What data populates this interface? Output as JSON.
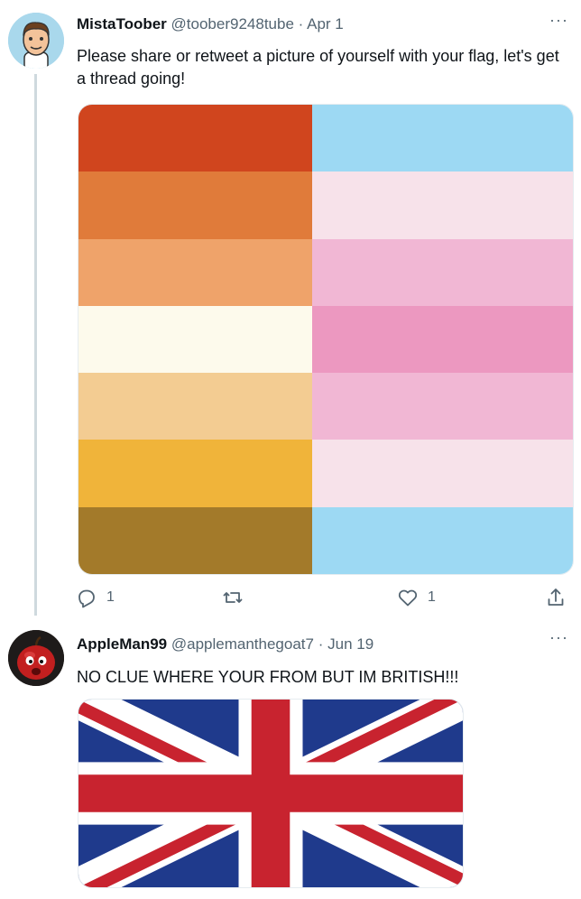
{
  "tweets": [
    {
      "author": {
        "name": "MistaToober",
        "handle": "@toober9248tube",
        "avatar_icon": "cartoon-boy-avatar"
      },
      "separator": "·",
      "date": "Apr 1",
      "more": "···",
      "text": "Please share or retweet a picture of yourself with your flag, let's get a thread going!",
      "media": {
        "type": "flag-image",
        "left_stripes": [
          "#d0451e",
          "#e07b3a",
          "#efa36a",
          "#fdfaec",
          "#f3cc92",
          "#f0b43a",
          "#a37a2a"
        ],
        "right_stripes": [
          "#9dd9f3",
          "#f7e2ea",
          "#f1b7d4",
          "#ec98c0",
          "#f1b7d4",
          "#f7e2ea",
          "#9dd9f3"
        ]
      },
      "actions": {
        "reply": {
          "icon": "reply-icon",
          "count": "1"
        },
        "retweet": {
          "icon": "retweet-icon",
          "count": ""
        },
        "like": {
          "icon": "heart-icon",
          "count": "1"
        },
        "share": {
          "icon": "share-icon"
        }
      }
    },
    {
      "author": {
        "name": "AppleMan99",
        "handle": "@applemanthegoat7",
        "avatar_icon": "red-apple-character-avatar"
      },
      "separator": "·",
      "date": "Jun 19",
      "more": "···",
      "text": "NO CLUE WHERE YOUR FROM BUT IM BRITISH!!!",
      "media": {
        "type": "union-jack-flag",
        "colors": {
          "blue": "#1f3a8c",
          "red": "#c8232f",
          "white": "#ffffff"
        }
      }
    }
  ]
}
